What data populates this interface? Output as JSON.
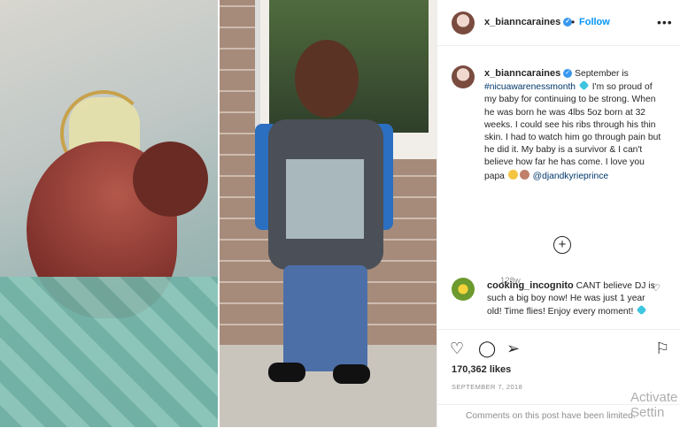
{
  "post": {
    "username": "x_bianncaraines",
    "verified_icon": "verified-badge-icon",
    "dot": "•",
    "follow_label": "Follow",
    "more_icon": "•••",
    "caption_parts": {
      "p1": "September is ",
      "hashtag": "#nicuawarenessmonth",
      "p2": " I'm so proud of my baby for continuing to be strong. When he was born he was 4lbs 5oz born at 32 weeks. I could see his ribs through his thin skin. I had to watch him go through pain but he did it. My baby is a survivor & I can't believe how far he has come. I love you papa ",
      "mention": "@djandkyrieprince"
    },
    "caption_time": "128w",
    "load_more_icon": "+",
    "comment": {
      "username": "cooking_incognito",
      "text": " CANT believe DJ is such a big boy now! He was just 1 year old! Time flies! Enjoy every moment! ",
      "like_icon": "♡"
    },
    "actions": {
      "like_icon": "♡",
      "comment_icon": "◯",
      "share_icon": "➢",
      "save_icon": "⚐"
    },
    "likes": "170,362 likes",
    "date": "SEPTEMBER 7, 2018",
    "comments_limited": "Comments on this post have been limited."
  },
  "watermark": "Activate Settin",
  "colors": {
    "link_blue": "#0095f6",
    "hashtag": "#00376b",
    "verified": "#3897f0",
    "muted": "#8e8e8e"
  }
}
